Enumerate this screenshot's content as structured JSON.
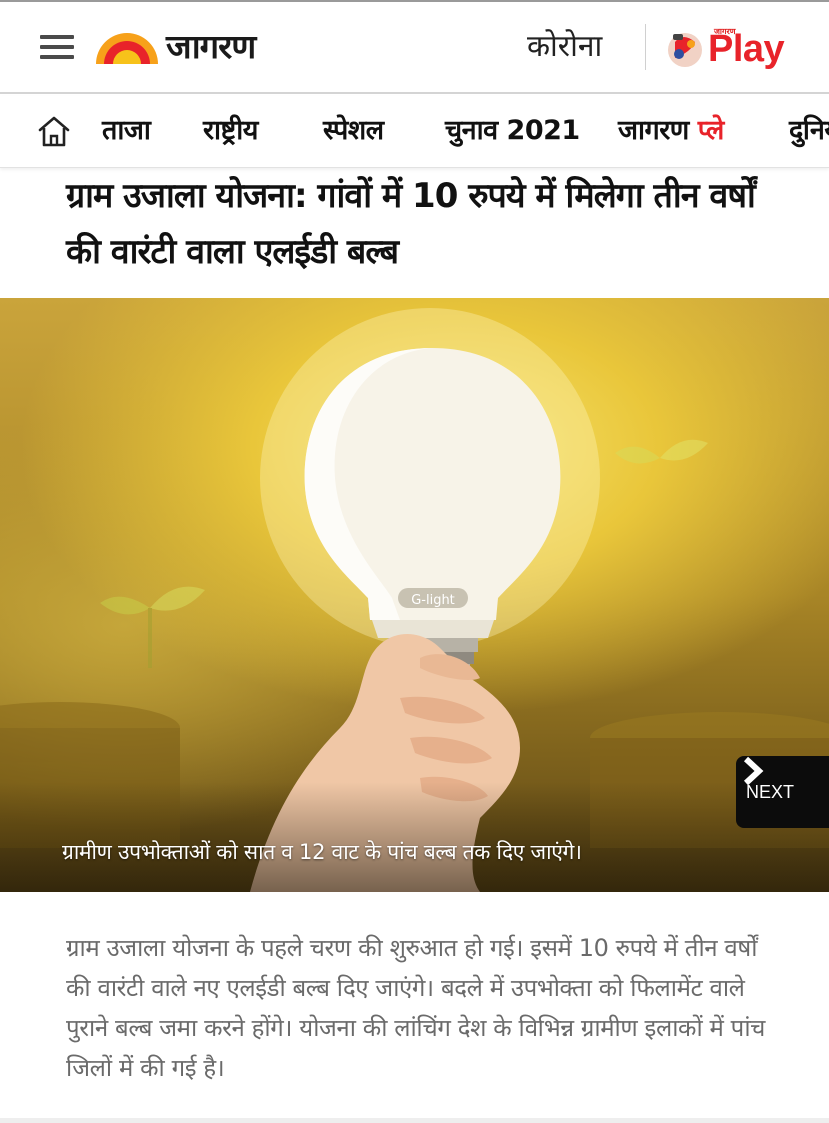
{
  "header": {
    "logo_text": "जागरण",
    "corona_link": "कोरोना",
    "play_logo_text": "Play",
    "play_badge_text": "जागरण",
    "brand_color": "#e8232a"
  },
  "nav": {
    "items": [
      {
        "label": "ताजा"
      },
      {
        "label": "राष्ट्रीय"
      },
      {
        "label": "स्पेशल"
      },
      {
        "label": "चुनाव 2021"
      },
      {
        "label_main": "जागरण",
        "label_accent": "प्ले"
      },
      {
        "label": "दुनिया"
      }
    ]
  },
  "article": {
    "headline": "ग्राम उजाला योजना: गांवों में 10 रुपये में मिलेगा तीन वर्षों की वारंटी वाला एलईडी बल्ब",
    "image_caption": "ग्रामीण उपभोक्ताओं को सात व 12 वाट के पांच बल्ब तक दिए जाएंगे।",
    "bulb_brand_text": "G-light",
    "next_label": "NEXT",
    "body": "ग्राम उजाला योजना के पहले चरण की शुरुआत हो गई। इसमें 10 रुपये में तीन वर्षों की वारंटी वाले नए एलईडी बल्ब दिए जाएंगे। बदले में उपभोक्ता को फिलामेंट वाले पुराने बल्ब जमा करने होंगे। योजना की लांचिंग देश के विभिन्न ग्रामीण इलाकों में पांच जिलों में की गई है।"
  },
  "icons": {
    "menu": "hamburger-menu-icon",
    "home": "home-icon",
    "next": "chevron-right-icon"
  }
}
